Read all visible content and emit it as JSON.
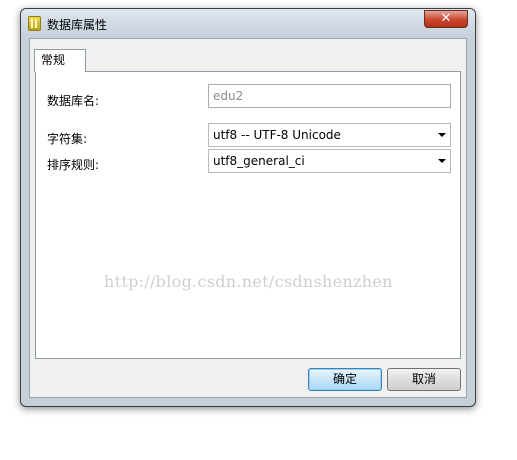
{
  "window": {
    "title": "数据库属性",
    "close_label": "✕"
  },
  "tabs": [
    {
      "label": "常规",
      "active": true
    }
  ],
  "form": {
    "db_name_label": "数据库名:",
    "db_name_value": "edu2",
    "charset_label": "字符集:",
    "charset_value": "utf8 -- UTF-8 Unicode",
    "collation_label": "排序规则:",
    "collation_value": "utf8_general_ci"
  },
  "watermark": "http://blog.csdn.net/csdnshenzhen",
  "buttons": {
    "ok_label": "确定",
    "cancel_label": "取消"
  }
}
